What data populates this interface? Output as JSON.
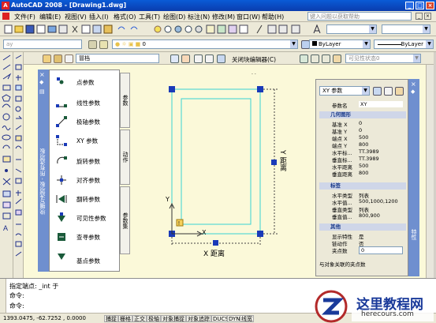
{
  "title_bar": {
    "app_title": "AutoCAD 2008 - [Drawing1.dwg]"
  },
  "menu": {
    "items": [
      "文件(F)",
      "编辑(E)",
      "视图(V)",
      "插入(I)",
      "格式(O)",
      "工具(T)",
      "绘图(D)",
      "标注(N)",
      "修改(M)",
      "窗口(W)",
      "帮助(H)"
    ],
    "help_search_placeholder": "键入问题以获取帮助"
  },
  "layers_toolbar": {
    "layer_value": "0",
    "color_value": "ByLayer",
    "linetype_value": "ByLayer",
    "combo_left": "ay"
  },
  "block_authoring": {
    "visibility_combo": "冒档",
    "close_editor_label": "关闭块编辑器(C)",
    "visibility_state_label": "可见性状态0"
  },
  "palette": {
    "title": "块编写选项板 - 所有选项板",
    "items": [
      "点参数",
      "线性参数",
      "极轴参数",
      "XY 参数",
      "旋转参数",
      "对齐参数",
      "翻转参数",
      "可见性参数",
      "查寻参数",
      "基点参数"
    ],
    "tabs": [
      "参数",
      "动作",
      "参数集"
    ]
  },
  "canvas": {
    "x_distance_label": "X 距离",
    "y_distance_label": "Y 距离",
    "axis_x": "X",
    "axis_y": "Y"
  },
  "properties": {
    "side_title": "特性",
    "selector": "XY 参数",
    "name_label": "参数名",
    "name_value": "XY",
    "sections": {
      "geometry": "几何图形",
      "labels": "标签",
      "misc": "其他"
    },
    "geometry_rows": [
      {
        "k": "基准 X",
        "v": "0"
      },
      {
        "k": "基准 Y",
        "v": "0"
      },
      {
        "k": "端点 X",
        "v": "500"
      },
      {
        "k": "端点 Y",
        "v": "800"
      },
      {
        "k": "水平标...",
        "v": "TT.3989"
      },
      {
        "k": "垂直标...",
        "v": "TT.3989"
      },
      {
        "k": "水平距离",
        "v": "500"
      },
      {
        "k": "垂直距离",
        "v": "800"
      }
    ],
    "label_rows": [
      {
        "k": "水平类型",
        "v": "列表"
      },
      {
        "k": "水平值...",
        "v": "500,1000,1200"
      },
      {
        "k": "垂直类型",
        "v": "列表"
      },
      {
        "k": "垂直值...",
        "v": "800,900"
      }
    ],
    "misc_rows": [
      {
        "k": "显示特性",
        "v": "是"
      },
      {
        "k": "链动作",
        "v": "否"
      },
      {
        "k": "夹点数",
        "v": "0"
      }
    ],
    "description": "与对象关联的夹点数"
  },
  "command": {
    "line1": "指定端点: _int 于",
    "line2": "命令:",
    "line3": "命令:"
  },
  "status": {
    "coords": "1393.0475, -62.7252 , 0.0000",
    "buttons": [
      "捕捉",
      "栅格",
      "正交",
      "极轴",
      "对象捕捉",
      "对象追踪",
      "DUCS",
      "DYN",
      "线宽"
    ]
  },
  "watermark": {
    "site_name": "这里教程网",
    "site_url": "herecours.com"
  },
  "colors": {
    "title_blue": "#0a4ac6",
    "canvas_bg": "#fbf9d9",
    "palette_blue": "#6f8fcf",
    "grip_blue": "#1a3ab8",
    "cyan_line": "#38d4d4"
  }
}
